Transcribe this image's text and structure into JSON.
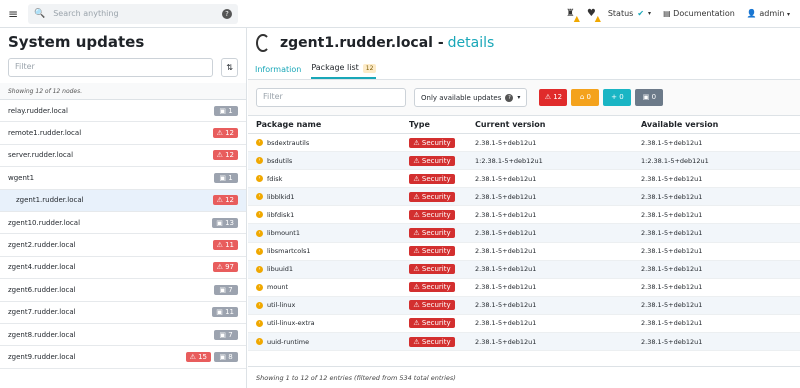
{
  "topbar": {
    "search_placeholder": "Search anything",
    "status_label": "Status",
    "documentation_label": "Documentation",
    "user_label": "admin"
  },
  "sidebar": {
    "title": "System updates",
    "filter_placeholder": "Filter",
    "showing": "Showing 12 of 12 nodes.",
    "nodes": [
      {
        "name": "relay.rudder.local",
        "badges": [
          {
            "color": "grey",
            "text": "1"
          }
        ]
      },
      {
        "name": "remote1.rudder.local",
        "badges": [
          {
            "color": "red",
            "text": "12"
          }
        ]
      },
      {
        "name": "server.rudder.local",
        "badges": [
          {
            "color": "red",
            "text": "12"
          }
        ]
      },
      {
        "name": "wgent1",
        "badges": [
          {
            "color": "grey",
            "text": "1"
          }
        ]
      },
      {
        "name": "zgent1.rudder.local",
        "badges": [
          {
            "color": "red",
            "text": "12"
          }
        ],
        "sub": true
      },
      {
        "name": "zgent10.rudder.local",
        "badges": [
          {
            "color": "grey",
            "text": "13"
          }
        ]
      },
      {
        "name": "zgent2.rudder.local",
        "badges": [
          {
            "color": "red",
            "text": "11"
          }
        ]
      },
      {
        "name": "zgent4.rudder.local",
        "badges": [
          {
            "color": "red",
            "text": "97"
          }
        ]
      },
      {
        "name": "zgent6.rudder.local",
        "badges": [
          {
            "color": "grey",
            "text": "7"
          }
        ]
      },
      {
        "name": "zgent7.rudder.local",
        "badges": [
          {
            "color": "grey",
            "text": "11"
          }
        ]
      },
      {
        "name": "zgent8.rudder.local",
        "badges": [
          {
            "color": "grey",
            "text": "7"
          }
        ]
      },
      {
        "name": "zgent9.rudder.local",
        "badges": [
          {
            "color": "red",
            "text": "15"
          },
          {
            "color": "grey",
            "text": "8"
          }
        ]
      }
    ]
  },
  "main": {
    "title": "zgent1.rudder.local -",
    "title_link": "details",
    "tabs": [
      {
        "label": "Information"
      },
      {
        "label": "Package list",
        "count": "12"
      }
    ],
    "filter_placeholder": "Filter",
    "dropdown_label": "Only available updates",
    "filter_buttons": [
      {
        "color": "red",
        "icon": "⚠",
        "count": "12"
      },
      {
        "color": "org",
        "icon": "⌂",
        "count": "0"
      },
      {
        "color": "teal",
        "icon": "+",
        "count": "0"
      },
      {
        "color": "slate",
        "icon": "▣",
        "count": "0"
      }
    ],
    "columns": [
      "Package name",
      "Type",
      "Current version",
      "Available version"
    ],
    "rows": [
      {
        "name": "bsdextrautils",
        "type": "Security",
        "current": "2.38.1-5+deb12u1",
        "available": "2.38.1-5+deb12u1"
      },
      {
        "name": "bsdutils",
        "type": "Security",
        "current": "1:2.38.1-5+deb12u1",
        "available": "1:2.38.1-5+deb12u1"
      },
      {
        "name": "fdisk",
        "type": "Security",
        "current": "2.38.1-5+deb12u1",
        "available": "2.38.1-5+deb12u1"
      },
      {
        "name": "libblkid1",
        "type": "Security",
        "current": "2.38.1-5+deb12u1",
        "available": "2.38.1-5+deb12u1"
      },
      {
        "name": "libfdisk1",
        "type": "Security",
        "current": "2.38.1-5+deb12u1",
        "available": "2.38.1-5+deb12u1"
      },
      {
        "name": "libmount1",
        "type": "Security",
        "current": "2.38.1-5+deb12u1",
        "available": "2.38.1-5+deb12u1"
      },
      {
        "name": "libsmartcols1",
        "type": "Security",
        "current": "2.38.1-5+deb12u1",
        "available": "2.38.1-5+deb12u1"
      },
      {
        "name": "libuuid1",
        "type": "Security",
        "current": "2.38.1-5+deb12u1",
        "available": "2.38.1-5+deb12u1"
      },
      {
        "name": "mount",
        "type": "Security",
        "current": "2.38.1-5+deb12u1",
        "available": "2.38.1-5+deb12u1"
      },
      {
        "name": "util-linux",
        "type": "Security",
        "current": "2.38.1-5+deb12u1",
        "available": "2.38.1-5+deb12u1"
      },
      {
        "name": "util-linux-extra",
        "type": "Security",
        "current": "2.38.1-5+deb12u1",
        "available": "2.38.1-5+deb12u1"
      },
      {
        "name": "uuid-runtime",
        "type": "Security",
        "current": "2.38.1-5+deb12u1",
        "available": "2.38.1-5+deb12u1"
      }
    ],
    "footer": "Showing 1 to 12 of 12 entries (filtered from 534 total entries)"
  }
}
